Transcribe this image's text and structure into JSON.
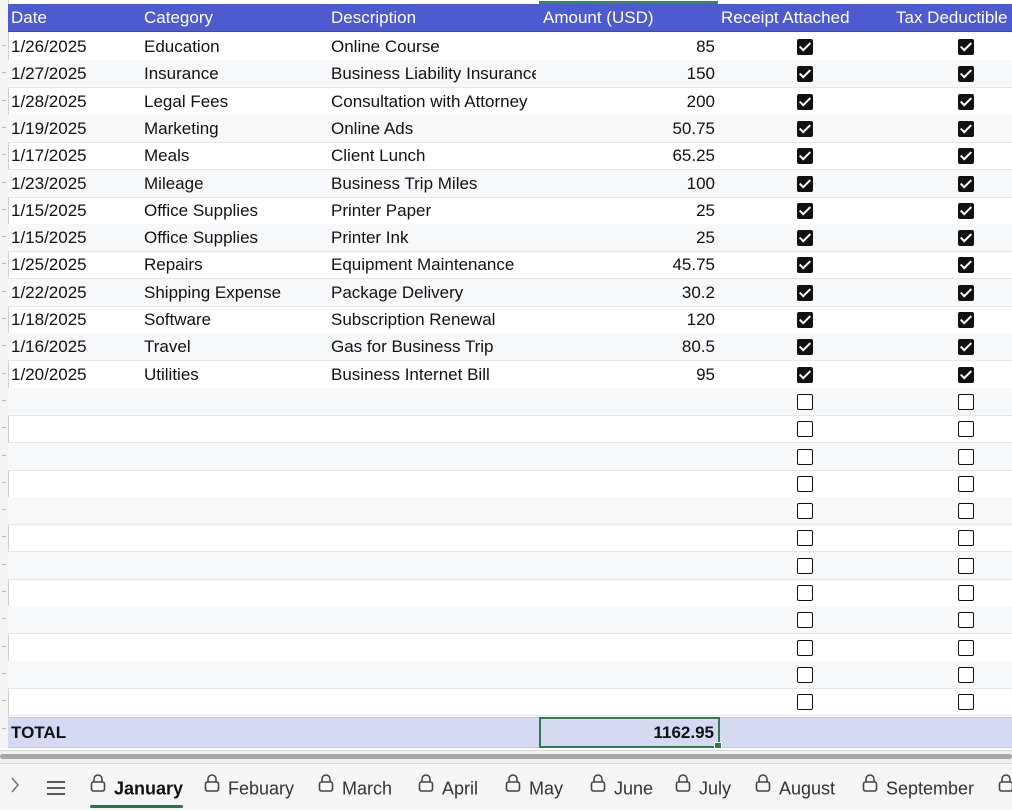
{
  "columns": {
    "date": "Date",
    "category": "Category",
    "description": "Description",
    "amount": "Amount (USD)",
    "receipt": "Receipt Attached",
    "tax": "Tax Deductible"
  },
  "rows": [
    {
      "date": "1/26/2025",
      "category": "Education",
      "description": "Online Course",
      "amount": "85",
      "receipt": true,
      "tax": true
    },
    {
      "date": "1/27/2025",
      "category": "Insurance",
      "description": "Business Liability Insurance",
      "amount": "150",
      "receipt": true,
      "tax": true
    },
    {
      "date": "1/28/2025",
      "category": "Legal Fees",
      "description": "Consultation with Attorney",
      "amount": "200",
      "receipt": true,
      "tax": true
    },
    {
      "date": "1/19/2025",
      "category": "Marketing",
      "description": "Online Ads",
      "amount": "50.75",
      "receipt": true,
      "tax": true
    },
    {
      "date": "1/17/2025",
      "category": "Meals",
      "description": "Client Lunch",
      "amount": "65.25",
      "receipt": true,
      "tax": true
    },
    {
      "date": "1/23/2025",
      "category": "Mileage",
      "description": "Business Trip Miles",
      "amount": "100",
      "receipt": true,
      "tax": true
    },
    {
      "date": "1/15/2025",
      "category": "Office Supplies",
      "description": "Printer Paper",
      "amount": "25",
      "receipt": true,
      "tax": true
    },
    {
      "date": "1/15/2025",
      "category": "Office Supplies",
      "description": "Printer Ink",
      "amount": "25",
      "receipt": true,
      "tax": true
    },
    {
      "date": "1/25/2025",
      "category": "Repairs",
      "description": "Equipment Maintenance",
      "amount": "45.75",
      "receipt": true,
      "tax": true
    },
    {
      "date": "1/22/2025",
      "category": "Shipping Expense",
      "description": "Package Delivery",
      "amount": "30.2",
      "receipt": true,
      "tax": true
    },
    {
      "date": "1/18/2025",
      "category": "Software",
      "description": "Subscription Renewal",
      "amount": "120",
      "receipt": true,
      "tax": true
    },
    {
      "date": "1/16/2025",
      "category": "Travel",
      "description": "Gas for Business Trip",
      "amount": "80.5",
      "receipt": true,
      "tax": true
    },
    {
      "date": "1/20/2025",
      "category": "Utilities",
      "description": "Business Internet Bill",
      "amount": "95",
      "receipt": true,
      "tax": true
    },
    {
      "date": "",
      "category": "",
      "description": "",
      "amount": "",
      "receipt": false,
      "tax": false
    },
    {
      "date": "",
      "category": "",
      "description": "",
      "amount": "",
      "receipt": false,
      "tax": false
    },
    {
      "date": "",
      "category": "",
      "description": "",
      "amount": "",
      "receipt": false,
      "tax": false
    },
    {
      "date": "",
      "category": "",
      "description": "",
      "amount": "",
      "receipt": false,
      "tax": false
    },
    {
      "date": "",
      "category": "",
      "description": "",
      "amount": "",
      "receipt": false,
      "tax": false
    },
    {
      "date": "",
      "category": "",
      "description": "",
      "amount": "",
      "receipt": false,
      "tax": false
    },
    {
      "date": "",
      "category": "",
      "description": "",
      "amount": "",
      "receipt": false,
      "tax": false
    },
    {
      "date": "",
      "category": "",
      "description": "",
      "amount": "",
      "receipt": false,
      "tax": false
    },
    {
      "date": "",
      "category": "",
      "description": "",
      "amount": "",
      "receipt": false,
      "tax": false
    },
    {
      "date": "",
      "category": "",
      "description": "",
      "amount": "",
      "receipt": false,
      "tax": false
    },
    {
      "date": "",
      "category": "",
      "description": "",
      "amount": "",
      "receipt": false,
      "tax": false
    },
    {
      "date": "",
      "category": "",
      "description": "",
      "amount": "",
      "receipt": false,
      "tax": false
    }
  ],
  "total": {
    "label": "TOTAL",
    "amount": "1162.95"
  },
  "tabs": [
    {
      "label": "January",
      "active": true
    },
    {
      "label": "Febuary",
      "active": false
    },
    {
      "label": "March",
      "active": false
    },
    {
      "label": "April",
      "active": false
    },
    {
      "label": "May",
      "active": false
    },
    {
      "label": "June",
      "active": false
    },
    {
      "label": "July",
      "active": false
    },
    {
      "label": "August",
      "active": false
    },
    {
      "label": "September",
      "active": false
    }
  ],
  "icons": {
    "prev": "chevron-right-icon",
    "menu": "hamburger-menu-icon",
    "tab": "lock-icon"
  },
  "colors": {
    "header_bg": "#4e5bd0",
    "total_bg": "#d6d9f3",
    "selection": "#2e7d4f",
    "active_tab_underline": "#1e7a45"
  }
}
